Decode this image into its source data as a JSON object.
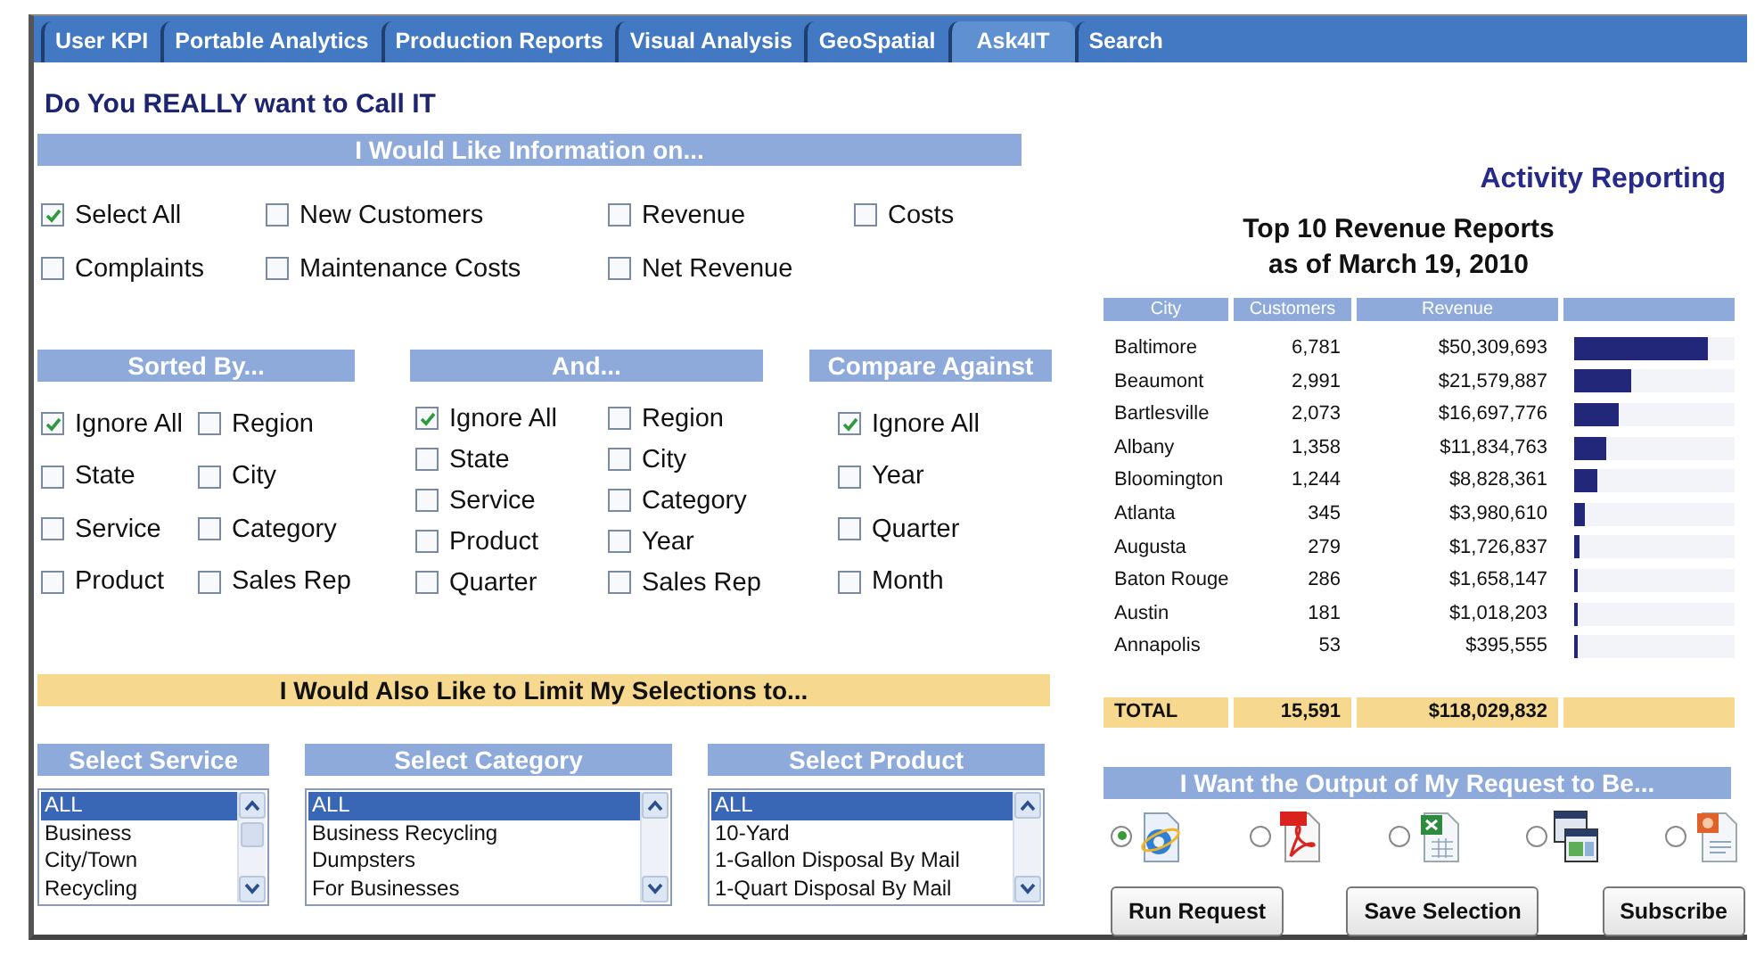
{
  "tabs": [
    {
      "label": "User KPI",
      "selected": false
    },
    {
      "label": "Portable Analytics",
      "selected": false
    },
    {
      "label": "Production Reports",
      "selected": false
    },
    {
      "label": "Visual Analysis",
      "selected": false
    },
    {
      "label": "GeoSpatial",
      "selected": false
    },
    {
      "label": "Ask4IT",
      "selected": true
    },
    {
      "label": "Search",
      "selected": false
    }
  ],
  "title": "Do You REALLY want to Call IT",
  "information": {
    "header": "I Would Like Information on...",
    "options": [
      {
        "label": "Select All",
        "checked": true
      },
      {
        "label": "New Customers",
        "checked": false
      },
      {
        "label": "Revenue",
        "checked": false
      },
      {
        "label": "Costs",
        "checked": false
      },
      {
        "label": "Complaints",
        "checked": false
      },
      {
        "label": "Maintenance Costs",
        "checked": false
      },
      {
        "label": "Net Revenue",
        "checked": false
      }
    ]
  },
  "sorted_by": {
    "header": "Sorted By...",
    "options": [
      {
        "label": "Ignore All",
        "checked": true
      },
      {
        "label": "Region",
        "checked": false
      },
      {
        "label": "State",
        "checked": false
      },
      {
        "label": "City",
        "checked": false
      },
      {
        "label": "Service",
        "checked": false
      },
      {
        "label": "Category",
        "checked": false
      },
      {
        "label": "Product",
        "checked": false
      },
      {
        "label": "Sales Rep",
        "checked": false
      }
    ]
  },
  "and": {
    "header": "And...",
    "options": [
      {
        "label": "Ignore All",
        "checked": true
      },
      {
        "label": "Region",
        "checked": false
      },
      {
        "label": "State",
        "checked": false
      },
      {
        "label": "City",
        "checked": false
      },
      {
        "label": "Service",
        "checked": false
      },
      {
        "label": "Category",
        "checked": false
      },
      {
        "label": "Product",
        "checked": false
      },
      {
        "label": "Year",
        "checked": false
      },
      {
        "label": "Quarter",
        "checked": false
      },
      {
        "label": "Sales Rep",
        "checked": false
      }
    ]
  },
  "compare_against": {
    "header": "Compare Against",
    "options": [
      {
        "label": "Ignore All",
        "checked": true
      },
      {
        "label": "Year",
        "checked": false
      },
      {
        "label": "Quarter",
        "checked": false
      },
      {
        "label": "Month",
        "checked": false
      }
    ]
  },
  "limit_header": "I Would Also Like to Limit My Selections to...",
  "lists": [
    {
      "header": "Select Service",
      "items": [
        {
          "label": "ALL",
          "selected": true
        },
        {
          "label": "Business",
          "selected": false
        },
        {
          "label": "City/Town",
          "selected": false
        },
        {
          "label": "Recycling",
          "selected": false
        }
      ]
    },
    {
      "header": "Select Category",
      "items": [
        {
          "label": "ALL",
          "selected": true
        },
        {
          "label": "Business Recycling",
          "selected": false
        },
        {
          "label": "Dumpsters",
          "selected": false
        },
        {
          "label": "For Businesses",
          "selected": false
        }
      ]
    },
    {
      "header": "Select Product",
      "items": [
        {
          "label": "ALL",
          "selected": true
        },
        {
          "label": "10-Yard",
          "selected": false
        },
        {
          "label": "1-Gallon Disposal By Mail",
          "selected": false
        },
        {
          "label": "1-Quart Disposal By Mail",
          "selected": false
        }
      ]
    }
  ],
  "report": {
    "heading": "Activity Reporting",
    "title_lines": [
      "Top 10 Revenue Reports",
      "as of March 19, 2010"
    ],
    "columns": [
      "City",
      "Customers",
      "Revenue"
    ],
    "rows": [
      {
        "city": "Baltimore",
        "customers": "6,781",
        "revenue": "$50,309,693",
        "level": 0.83
      },
      {
        "city": "Beaumont",
        "customers": "2,991",
        "revenue": "$21,579,887",
        "level": 0.356
      },
      {
        "city": "Bartlesville",
        "customers": "2,073",
        "revenue": "$16,697,776",
        "level": 0.275
      },
      {
        "city": "Albany",
        "customers": "1,358",
        "revenue": "$11,834,763",
        "level": 0.195
      },
      {
        "city": "Bloomington",
        "customers": "1,244",
        "revenue": "$8,828,361",
        "level": 0.146
      },
      {
        "city": "Atlanta",
        "customers": "345",
        "revenue": "$3,980,610",
        "level": 0.066
      },
      {
        "city": "Augusta",
        "customers": "279",
        "revenue": "$1,726,837",
        "level": 0.028
      },
      {
        "city": "Baton Rouge",
        "customers": "286",
        "revenue": "$1,658,147",
        "level": 0.027
      },
      {
        "city": "Austin",
        "customers": "181",
        "revenue": "$1,018,203",
        "level": 0.017
      },
      {
        "city": "Annapolis",
        "customers": "53",
        "revenue": "$395,555",
        "level": 0.007
      }
    ],
    "total": {
      "label": "TOTAL",
      "customers": "15,591",
      "revenue": "$118,029,832"
    }
  },
  "output": {
    "header": "I Want the Output of My Request to Be...",
    "formats": [
      {
        "kind": "web",
        "selected": true
      },
      {
        "kind": "pdf",
        "selected": false
      },
      {
        "kind": "spreadsheet",
        "selected": false
      },
      {
        "kind": "windows",
        "selected": false
      },
      {
        "kind": "slides",
        "selected": false
      }
    ]
  },
  "buttons": [
    "Run Request",
    "Save Selection",
    "Subscribe"
  ]
}
